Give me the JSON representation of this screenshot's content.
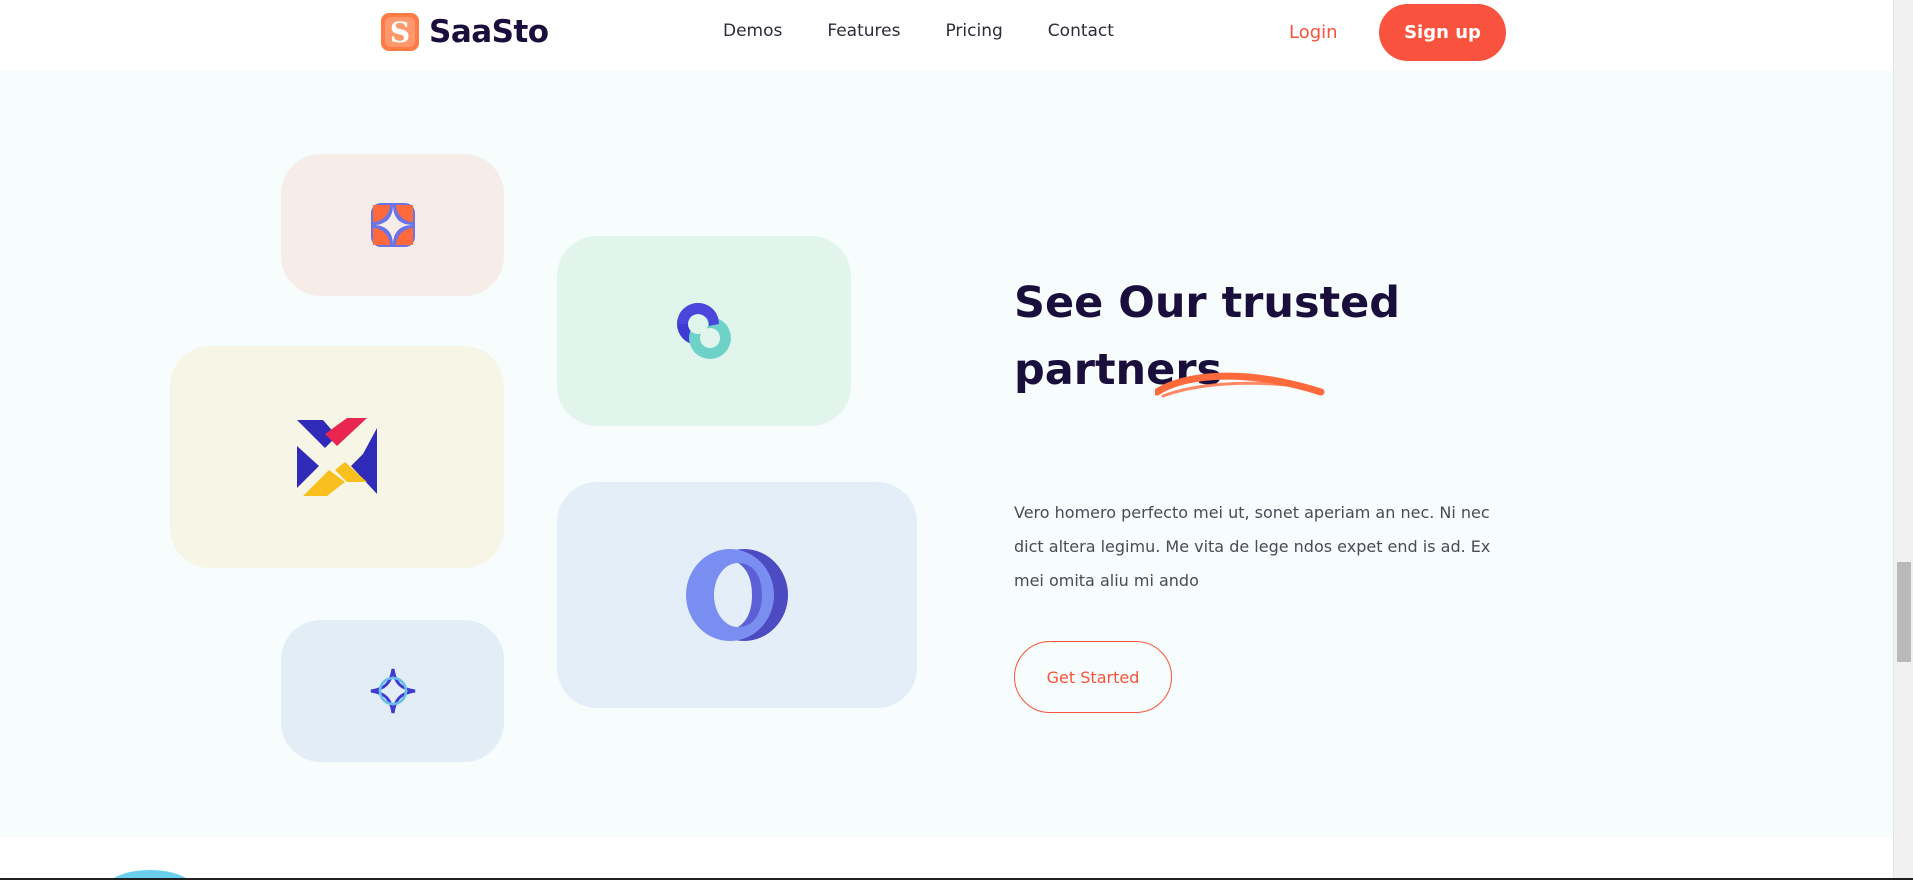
{
  "header": {
    "brand": "SaaSto",
    "brand_letter": "S",
    "nav": [
      "Demos",
      "Features",
      "Pricing",
      "Contact"
    ],
    "login_label": "Login",
    "signup_label": "Sign up"
  },
  "partners": {
    "heading_line1": "See Our trusted",
    "heading_line2": "partners",
    "description": "Vero homero perfecto mei ut, sonet aperiam an nec. Ni nec dict altera legimu. Me vita de lege ndos expet end is ad. Ex mei omita aliu mi ando",
    "cta_label": "Get Started",
    "logos": [
      "quatrefoil-logo-icon",
      "ring-swirl-logo-icon",
      "x-mark-logo-icon",
      "o-ring-logo-icon",
      "star-knot-logo-icon"
    ]
  },
  "colors": {
    "accent": "#f7533a",
    "heading": "#1a0f3c",
    "section_bg": "#f7fcfc"
  }
}
